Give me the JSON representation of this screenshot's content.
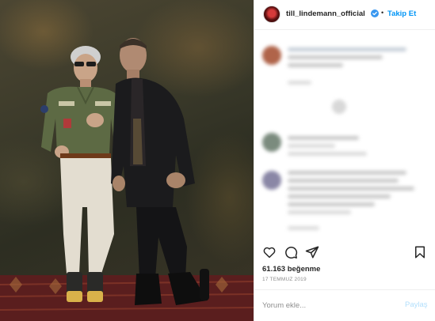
{
  "post": {
    "photo_alt": "",
    "account": {
      "username": "till_lindemann_official",
      "verified": true,
      "separator": "•",
      "follow_label": "Takip Et"
    },
    "likes_text": "61.163 beğenme",
    "date_text": "17 TEMMUZ 2019",
    "comment_box": {
      "placeholder": "Yorum ekle...",
      "submit_label": "Paylaş"
    }
  },
  "icons": {
    "like": "heart-icon",
    "comment": "comment-icon",
    "share": "share-icon",
    "save": "bookmark-icon",
    "verified": "verified-badge-icon"
  },
  "colors": {
    "accent": "#0095f6",
    "post_disabled": "#b2dffc",
    "muted": "#8e8e8e",
    "text": "#262626",
    "border": "#efefef"
  }
}
